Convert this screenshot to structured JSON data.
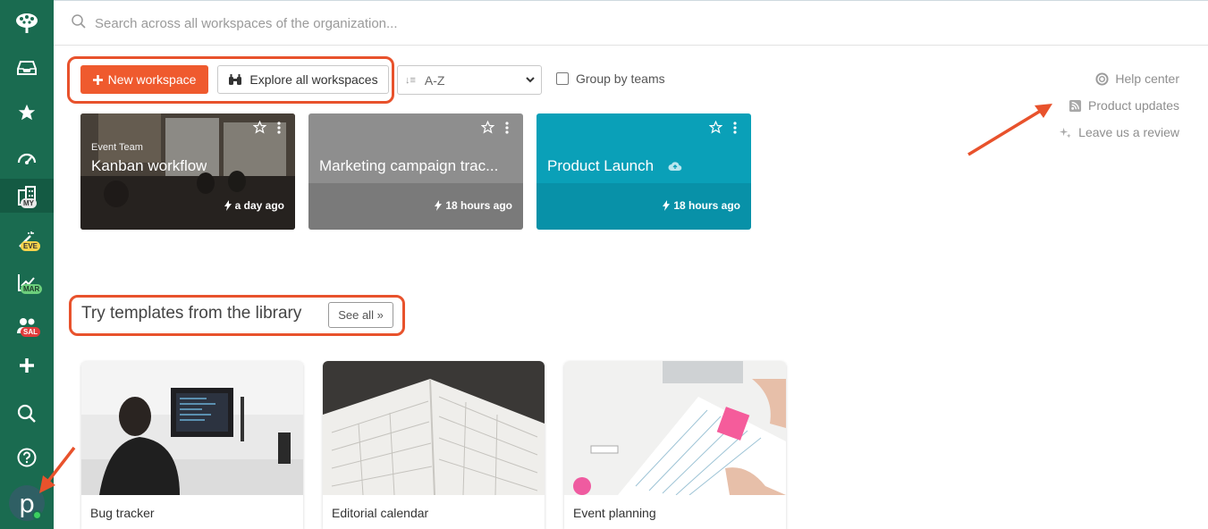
{
  "search": {
    "placeholder": "Search across all workspaces of the organization..."
  },
  "sidebar": {
    "badges": {
      "my": "MY",
      "eve": "EVE",
      "mar": "MAR",
      "sal": "SAL"
    },
    "avatar_letter": "p"
  },
  "toolbar": {
    "new_workspace_label": "New workspace",
    "explore_label": "Explore all workspaces",
    "sort_value": "A-Z",
    "group_by_teams_label": "Group by teams"
  },
  "right_links": {
    "help_center": "Help center",
    "product_updates": "Product updates",
    "leave_review": "Leave us a review"
  },
  "workspaces": [
    {
      "team": "Event Team",
      "title": "Kanban workflow",
      "updated": "a day ago"
    },
    {
      "title": "Marketing campaign trac...",
      "updated": "18 hours ago"
    },
    {
      "title": "Product Launch",
      "updated": "18 hours ago"
    }
  ],
  "templates": {
    "heading": "Try templates from the library",
    "see_all_label": "See all »",
    "items": [
      {
        "name": "Bug tracker"
      },
      {
        "name": "Editorial calendar"
      },
      {
        "name": "Event planning"
      }
    ]
  },
  "colors": {
    "sidebar": "#1a6b50",
    "accent": "#ef5a2e",
    "annotation": "#e8522c",
    "card_gray": "#8a8a8a",
    "card_teal": "#0aa0b8"
  }
}
